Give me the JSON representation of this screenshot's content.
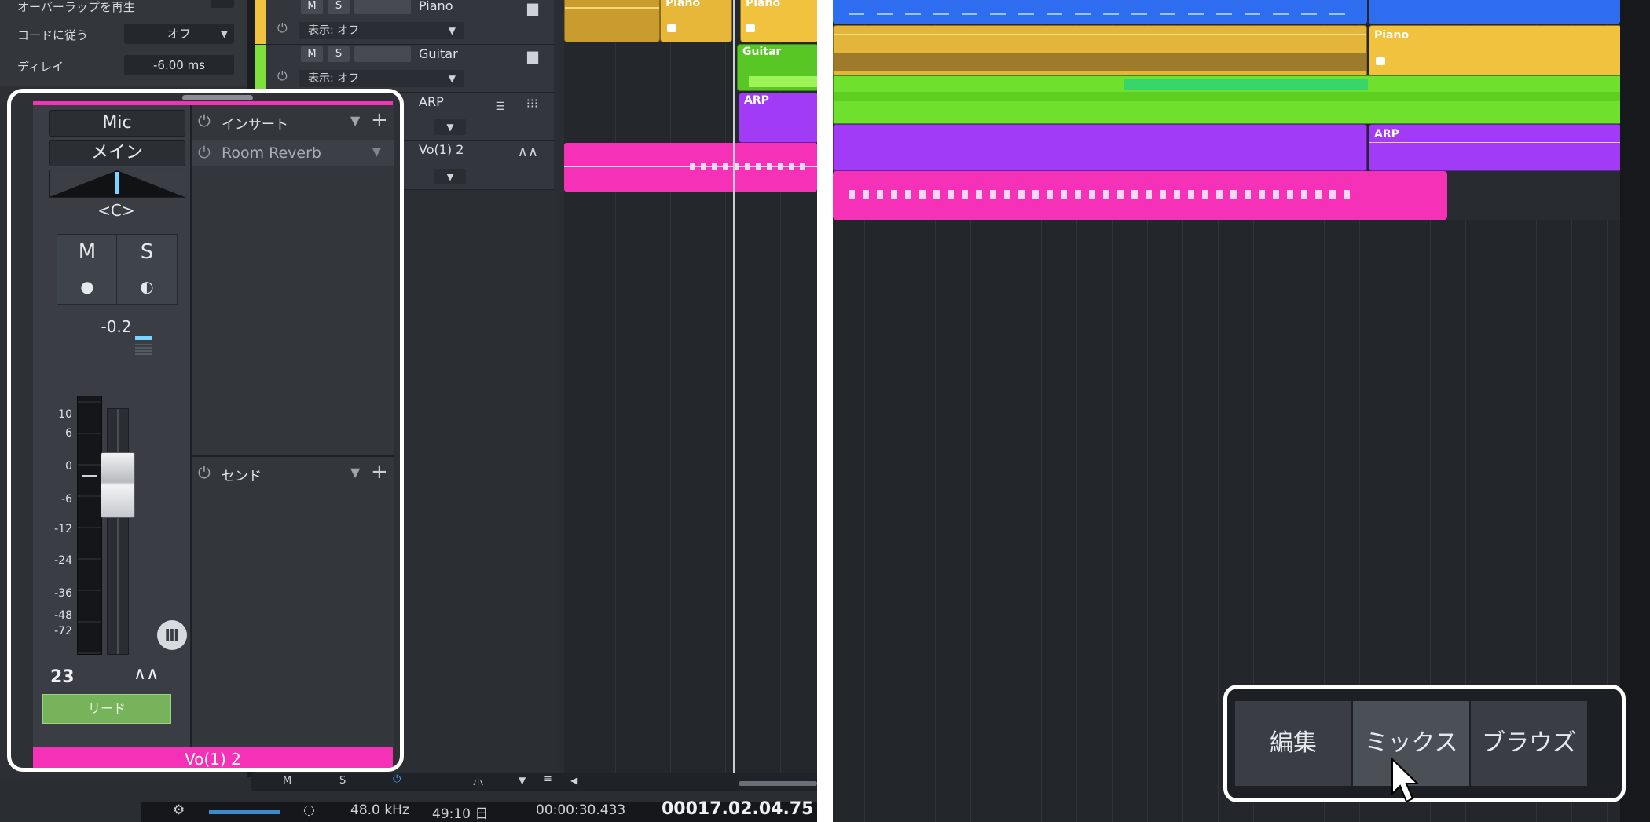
{
  "inspector": {
    "rows": [
      {
        "label": "オーバーラップを再生",
        "value": ""
      },
      {
        "label": "コードに従う",
        "value": "オフ"
      },
      {
        "label": "ディレイ",
        "value": "-6.00 ms"
      }
    ]
  },
  "tracks": [
    {
      "name": "Piano",
      "display": "表示: オフ",
      "m": "M",
      "s": "S",
      "color": "#f0c23e"
    },
    {
      "name": "Guitar",
      "display": "表示: オフ",
      "m": "M",
      "s": "S",
      "color": "#7ee03a"
    },
    {
      "name": "ARP",
      "display": "",
      "m": "",
      "s": "",
      "color": "#a13bf5"
    },
    {
      "name": "Vo(1) 2",
      "display": "",
      "m": "",
      "s": "",
      "color": "#f531b8"
    }
  ],
  "clips_left": [
    {
      "label": "Piano"
    },
    {
      "label": "Piano"
    },
    {
      "label": "Guitar"
    },
    {
      "label": "ARP"
    }
  ],
  "clips_right": [
    {
      "label": "Piano"
    },
    {
      "label": "ARP"
    }
  ],
  "strip": {
    "input": "Mic",
    "output": "メイン",
    "pan": "<C>",
    "mute": "M",
    "solo": "S",
    "volume": "-0.2",
    "scale": [
      "10",
      "6",
      "0",
      "-6",
      "-12",
      "-24",
      "-36",
      "-48",
      "-72"
    ],
    "channel_number": "23",
    "group_tag": "リード",
    "channel_name": "Vo(1) 2",
    "insert_header": "インサート",
    "insert_plugin": "Room Reverb",
    "send_header": "センド"
  },
  "bottombar": {
    "m": "M",
    "s": "S",
    "size": "小"
  },
  "status": {
    "sample_rate": "48.0 kHz",
    "time_left": "49:10 日",
    "time": "00:00:30.433",
    "bars": "00017.02.04.75"
  },
  "view_switch": {
    "edit": "編集",
    "mix": "ミックス",
    "browse": "ブラウズ"
  },
  "colors": {
    "piano": "#f0c23e",
    "guitar": "#7ee03a",
    "arp": "#a13bf5",
    "vocal": "#f531b8",
    "blue": "#2f6df0"
  }
}
